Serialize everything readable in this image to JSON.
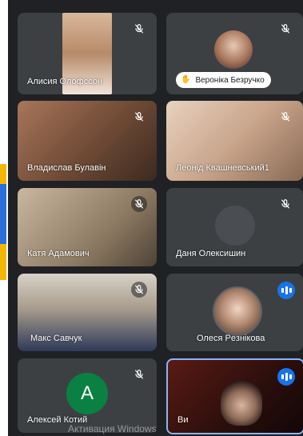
{
  "participants": [
    {
      "name": "Алисия Олофссон"
    },
    {
      "name": "Вероніка Безручко"
    },
    {
      "name": "Владислав Булавін"
    },
    {
      "name": "Леонід Квашневський1"
    },
    {
      "name": "Катя Адамович"
    },
    {
      "name": "Даня Олексишин"
    },
    {
      "name": "Макс Савчук"
    },
    {
      "name": "Олеся Рeзнікова"
    },
    {
      "name": "Алексей Котий",
      "initial": "A"
    },
    {
      "name": "Ви"
    }
  ],
  "watermark": "Активация Windows",
  "colors": {
    "speaking": "#1a73e8",
    "avatar_green": "#0b8043",
    "panel_bg": "#202124"
  }
}
